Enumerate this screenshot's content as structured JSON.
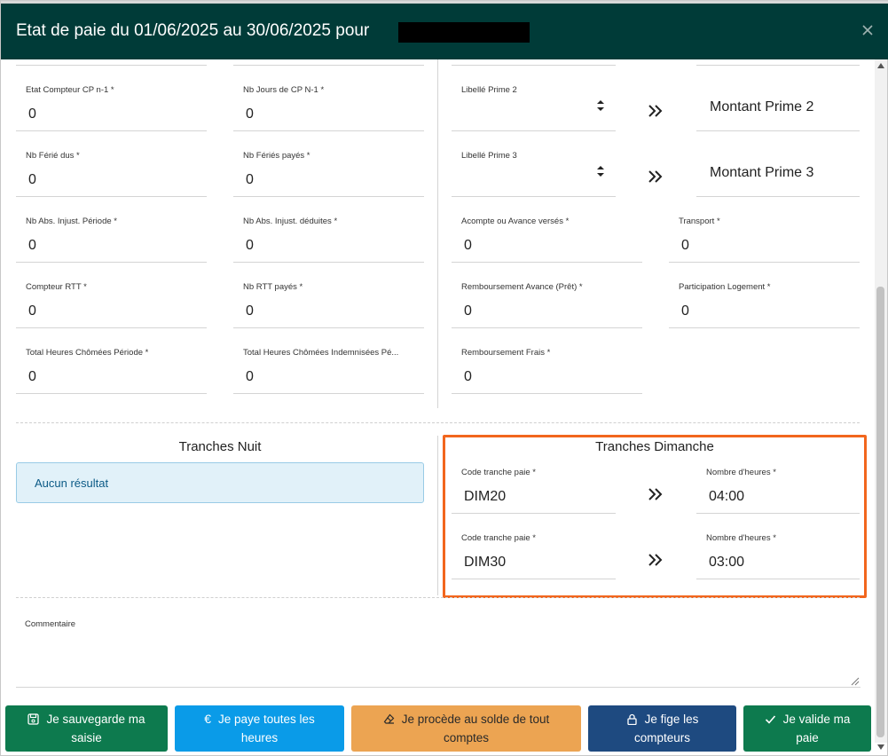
{
  "dialog": {
    "title": "Etat de paie du 01/06/2025 au 30/06/2025 pour"
  },
  "left_fields": [
    {
      "label": "Etat Compteur CP n-1 *",
      "value": "0"
    },
    {
      "label": "Nb Jours de CP N-1 *",
      "value": "0"
    },
    {
      "label": "Nb Férié dus *",
      "value": "0"
    },
    {
      "label": "Nb Fériés payés *",
      "value": "0"
    },
    {
      "label": "Nb Abs. Injust. Période *",
      "value": "0"
    },
    {
      "label": "Nb Abs. Injust. déduites *",
      "value": "0"
    },
    {
      "label": "Compteur RTT *",
      "value": "0"
    },
    {
      "label": "Nb RTT payés *",
      "value": "0"
    },
    {
      "label": "Total Heures Chômées Période *",
      "value": "0"
    },
    {
      "label": "Total Heures Chômées Indemnisées Pé...",
      "value": "0"
    }
  ],
  "primes": [
    {
      "label": "Libellé Prime 2",
      "amount_placeholder": "Montant Prime 2"
    },
    {
      "label": "Libellé Prime 3",
      "amount_placeholder": "Montant Prime 3"
    }
  ],
  "right_fields": [
    {
      "label": "Acompte ou Avance versés *",
      "value": "0"
    },
    {
      "label": "Transport *",
      "value": "0"
    },
    {
      "label": "Remboursement Avance (Prêt) *",
      "value": "0"
    },
    {
      "label": "Participation Logement *",
      "value": "0"
    },
    {
      "label": "Remboursement Frais *",
      "value": "0"
    }
  ],
  "tranches_nuit": {
    "title": "Tranches Nuit",
    "empty_message": "Aucun résultat"
  },
  "tranches_dimanche": {
    "title": "Tranches Dimanche",
    "rows": [
      {
        "code_label": "Code tranche paie *",
        "code": "DIM20",
        "hours_label": "Nombre d'heures *",
        "hours": "04:00"
      },
      {
        "code_label": "Code tranche paie *",
        "code": "DIM30",
        "hours_label": "Nombre d'heures *",
        "hours": "03:00"
      }
    ]
  },
  "comment": {
    "label": "Commentaire",
    "value": ""
  },
  "actions": {
    "save": {
      "line1": "Je sauvegarde ma",
      "line2": "saisie"
    },
    "pay_all": {
      "line1": "Je paye toutes les",
      "line2": "heures"
    },
    "balance": {
      "line1": "Je procède au solde de tout",
      "line2": "comptes"
    },
    "freeze": {
      "line1": "Je fige les",
      "line2": "compteurs"
    },
    "validate": {
      "line1": "Je valide ma",
      "line2": "paie"
    }
  },
  "colors": {
    "header": "#003b38",
    "highlight": "#f2661d",
    "green": "#0d7a4e",
    "blue": "#0a9be8",
    "orange": "#eca452",
    "navy": "#1e4a80"
  }
}
